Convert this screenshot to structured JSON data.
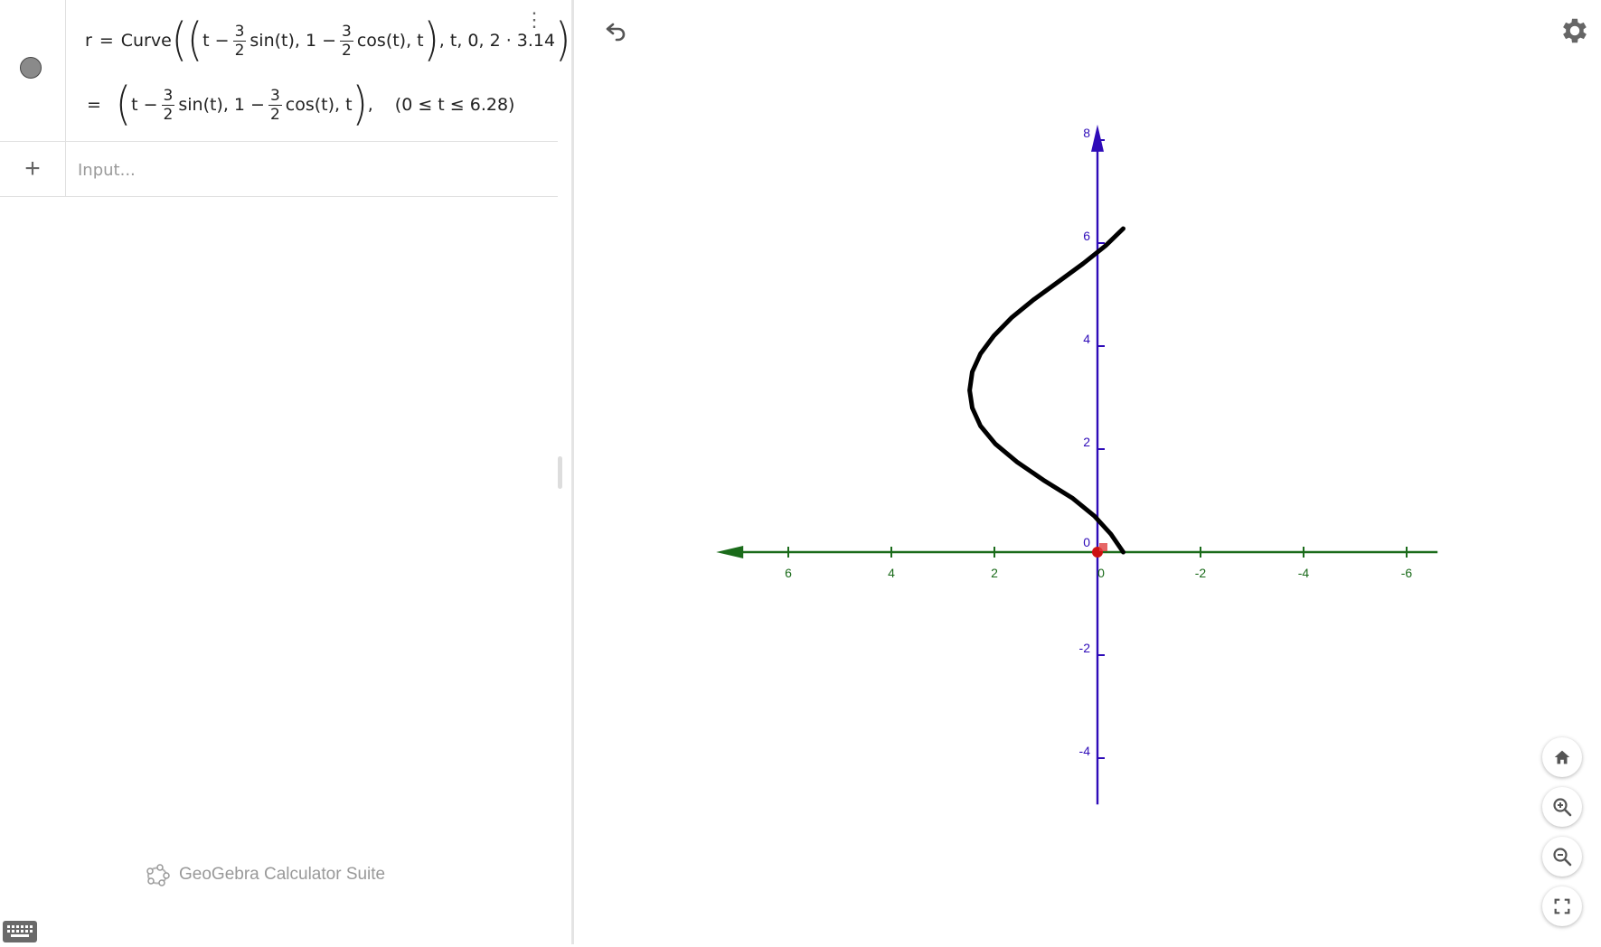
{
  "algebra": {
    "entry": {
      "name": "r",
      "command": "Curve",
      "t_minus": "t −",
      "frac_num": "3",
      "frac_den": "2",
      "sin_part": "sin(t), 1 −",
      "cos_part": "cos(t), t",
      "params": ", t, 0, 2 · 3.14",
      "output_eq": "=",
      "output_cos_part": "cos(t), t",
      "output_range": "(0 ≤ t ≤ 6.28)"
    },
    "input_placeholder": "Input...",
    "brand": "GeoGebra Calculator Suite"
  },
  "graphics": {
    "x_ticks": [
      "6",
      "4",
      "2",
      "0",
      "-2",
      "-4",
      "-6"
    ],
    "y_ticks": [
      "8",
      "6",
      "4",
      "2",
      "0",
      "-2",
      "-4"
    ],
    "colors": {
      "x_axis": "#1a6b1a",
      "y_axis": "#2e0bb8",
      "curve": "#000000",
      "point": "#cc1111"
    },
    "icons": [
      "undo-icon",
      "gear-icon",
      "home-icon",
      "zoom-in-icon",
      "zoom-out-icon",
      "fullscreen-icon"
    ]
  },
  "chart_data": {
    "type": "line",
    "title": "",
    "xlabel": "",
    "ylabel": "",
    "x_reversed": true,
    "xlim": [
      7.4,
      -6.6
    ],
    "ylim": [
      -4.9,
      8.3
    ],
    "series": [
      {
        "expression": "(t − 3/2 sin(t), 1 − 3/2 cos(t), t), 0 ≤ t ≤ 6.28",
        "x": [
          -0.5,
          -0.26,
          0.06,
          0.49,
          1.05,
          1.56,
          1.98,
          2.27,
          2.43,
          2.48,
          2.43,
          2.27,
          2.01,
          1.67,
          1.24,
          0.76,
          0.28,
          -0.16,
          -0.5
        ],
        "y": [
          0.0,
          0.35,
          0.7,
          1.05,
          1.4,
          1.75,
          2.1,
          2.45,
          2.8,
          3.14,
          3.5,
          3.85,
          4.2,
          4.55,
          4.9,
          5.25,
          5.6,
          5.95,
          6.28
        ]
      }
    ],
    "points": [
      {
        "x": 0,
        "y": 0
      }
    ]
  }
}
